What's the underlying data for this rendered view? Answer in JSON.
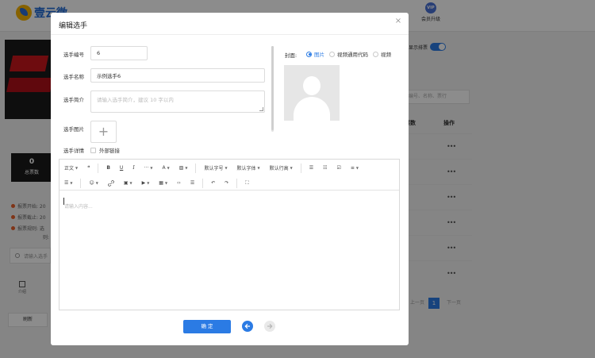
{
  "background": {
    "brand": "壹云微",
    "vip": {
      "badge": "VIP",
      "label": "会员升级"
    },
    "stats": {
      "count": "0",
      "count_label": "总票数"
    },
    "info_lines": [
      "报票开始: 20",
      "报票截止: 20",
      "报票规则: 选",
      "则:"
    ],
    "search_placeholder": "请输入选手",
    "calendar_label": "介绍",
    "refresh_label": "刷新",
    "toggle_label": "显示排票",
    "filter_placeholder": "编号、名称、票行",
    "columns": {
      "votes": "票数",
      "actions": "操作"
    },
    "row_action": "•••",
    "pager": {
      "prev": "上一页",
      "current": "1",
      "next": "下一页"
    }
  },
  "modal": {
    "title": "编辑选手",
    "close_glyph": "×",
    "fields": {
      "number": {
        "label": "选手编号",
        "value": "6"
      },
      "name": {
        "label": "选手名称",
        "value": "示例选手6"
      },
      "intro": {
        "label": "选手简介",
        "placeholder": "请输入选手简介，建议 10 字以内"
      },
      "image": {
        "label": "选手图片",
        "upload_glyph": "+"
      },
      "detail": {
        "label": "选手详情",
        "external_link": "外部链接"
      }
    },
    "cover": {
      "label": "封面:",
      "options": [
        {
          "label": "图片",
          "selected": true
        },
        {
          "label": "视频通用代码",
          "selected": false
        },
        {
          "label": "视频",
          "selected": false
        }
      ]
    },
    "editor": {
      "toolbar_row1": {
        "paragraph": "正文",
        "quote": "❝",
        "bold": "B",
        "underline": "U",
        "italic": "I",
        "more": "···",
        "font_color": "A",
        "bg_color": "▨",
        "font_size": "默认字号",
        "font_family": "默认字体",
        "line_height": "默认行高",
        "bullet_list": "☰",
        "number_list": "☷",
        "todo": "☑",
        "align": "≡"
      },
      "toolbar_row2": {
        "indent": "☰",
        "emoji": "☺",
        "link": "🔗",
        "image": "▣",
        "video": "▶",
        "table": "▦",
        "code": "‹›",
        "divider": "☰",
        "undo": "↶",
        "redo": "↷",
        "fullscreen": "⛶"
      },
      "placeholder": "请输入内容..."
    },
    "confirm_label": "确 定"
  },
  "colors": {
    "primary": "#2b7be4",
    "overlay": "rgba(0,0,0,0.45)"
  }
}
